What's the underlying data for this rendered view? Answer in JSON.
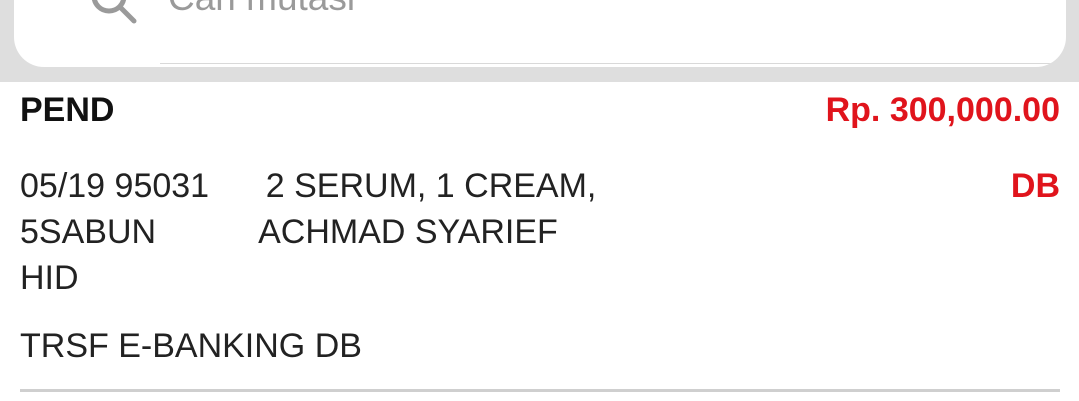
{
  "search": {
    "placeholder": "Cari mutasi",
    "icon": "search-icon"
  },
  "transaction": {
    "status": "PEND",
    "amount": "Rp. 300,000.00",
    "type": "DB",
    "description_lines": [
      "05/19 95031      2 SERUM, 1 CREAM,",
      "5SABUN           ACHMAD SYARIEF",
      "HID"
    ],
    "channel": "TRSF E-BANKING DB"
  },
  "colors": {
    "accent_red": "#e0141c",
    "band_gray": "#dedede"
  }
}
